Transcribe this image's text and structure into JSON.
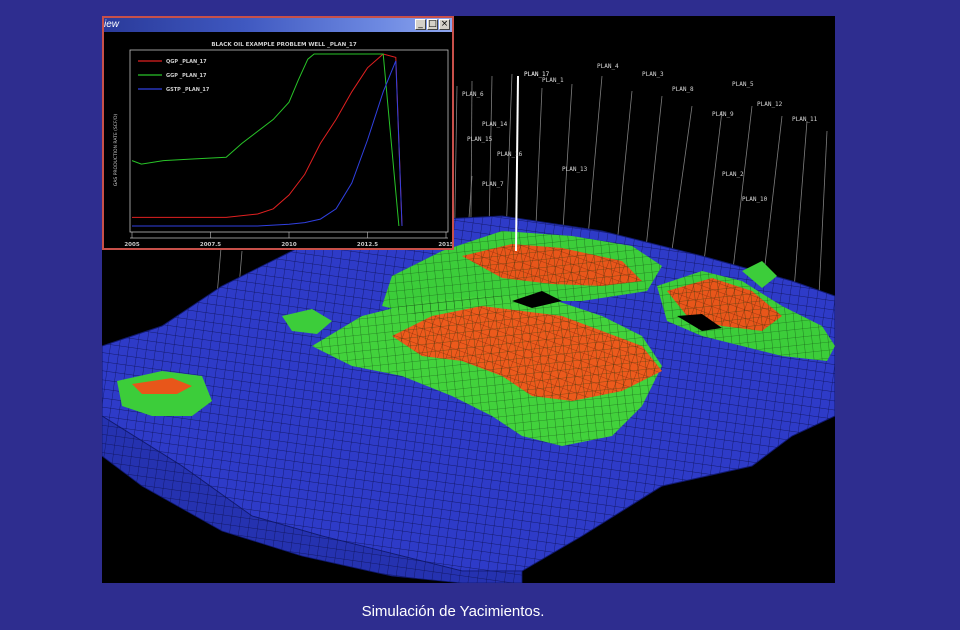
{
  "window": {
    "title": "iew"
  },
  "chart_data": {
    "type": "line",
    "title": "BLACK OIL EXAMPLE PROBLEM WELL _PLAN_17",
    "ylabel": "GAS PRODUCTION RATE (SCF/D)",
    "xlim": [
      2005,
      2015
    ],
    "x_ticks": [
      "2005",
      "2007.5",
      "2010",
      "2012.5",
      "2015"
    ],
    "series": [
      {
        "name": "QGP _PLAN_17",
        "color": "#e02020",
        "x": [
          2005,
          2006,
          2007,
          2008,
          2009,
          2009.5,
          2010,
          2010.5,
          2011,
          2011.5,
          2012,
          2012.5,
          2013,
          2013.4,
          2013.6
        ],
        "y": [
          0.05,
          0.05,
          0.05,
          0.05,
          0.07,
          0.1,
          0.18,
          0.3,
          0.48,
          0.62,
          0.78,
          0.92,
          1.0,
          0.98,
          0.0
        ]
      },
      {
        "name": "GGP _PLAN_17",
        "color": "#28c428",
        "x": [
          2005,
          2005.3,
          2006,
          2007,
          2008,
          2008.5,
          2009,
          2009.5,
          2010,
          2010.3,
          2010.6,
          2010.8,
          2011,
          2011.5,
          2012,
          2012.5,
          2013,
          2013.5
        ],
        "y": [
          0.38,
          0.36,
          0.38,
          0.39,
          0.4,
          0.48,
          0.55,
          0.62,
          0.72,
          0.85,
          0.97,
          1.0,
          1.0,
          1.0,
          1.0,
          1.0,
          1.0,
          0.0
        ]
      },
      {
        "name": "GSTP _PLAN_17",
        "color": "#3040e0",
        "x": [
          2005,
          2009,
          2010,
          2010.5,
          2011,
          2011.5,
          2012,
          2012.5,
          2013,
          2013.4,
          2013.6
        ],
        "y": [
          0.0,
          0.0,
          0.01,
          0.02,
          0.04,
          0.1,
          0.25,
          0.5,
          0.78,
          0.96,
          0.0
        ]
      }
    ]
  },
  "scene": {
    "well_labels": [
      "PLAN_17",
      "PLAN_1",
      "PLAN_4",
      "PLAN_3",
      "PLAN_8",
      "PLAN_5",
      "PLAN_12",
      "PLAN_9",
      "PLAN_11",
      "PLAN_6",
      "PLAN_14",
      "PLAN_15",
      "PLAN_16",
      "PLAN_13",
      "PLAN_2",
      "PLAN_7",
      "PLAN_10"
    ]
  },
  "caption": "Simulación de Yacimientos."
}
